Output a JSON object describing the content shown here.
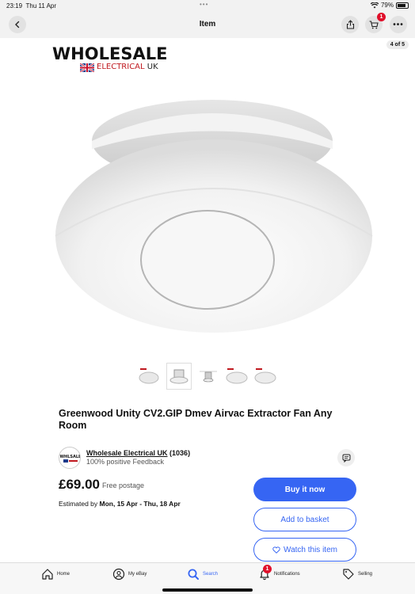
{
  "status_bar": {
    "time": "23:19",
    "date": "Thu 11 Apr",
    "battery": "79%"
  },
  "nav": {
    "title": "Item",
    "cart_count": "1",
    "more": "•••"
  },
  "hero": {
    "counter": "4 of 5",
    "logo_main": "WHOLESALE",
    "logo_sub": "ELECTRICAL",
    "logo_uk": "UK"
  },
  "item": {
    "title": "Greenwood Unity CV2.GIP Dmev Airvac Extractor Fan Any Room",
    "price": "£69.00",
    "postage": "Free postage",
    "estimate_prefix": "Estimated by ",
    "estimate_dates": "Mon, 15 Apr - Thu, 18 Apr"
  },
  "seller": {
    "name": "Wholesale Electrical UK",
    "count": " (1036)",
    "feedback": "100% positive Feedback"
  },
  "buttons": {
    "buy": "Buy it now",
    "basket": "Add to basket",
    "watch": "Watch this item"
  },
  "tabs": [
    {
      "label": "Home",
      "icon": "home-icon"
    },
    {
      "label": "My eBay",
      "icon": "user-icon"
    },
    {
      "label": "Search",
      "icon": "search-icon"
    },
    {
      "label": "Notifications",
      "icon": "bell-icon",
      "badge": "1"
    },
    {
      "label": "Selling",
      "icon": "tag-icon"
    }
  ],
  "colors": {
    "accent": "#3665f3",
    "badge": "#e0102b"
  }
}
